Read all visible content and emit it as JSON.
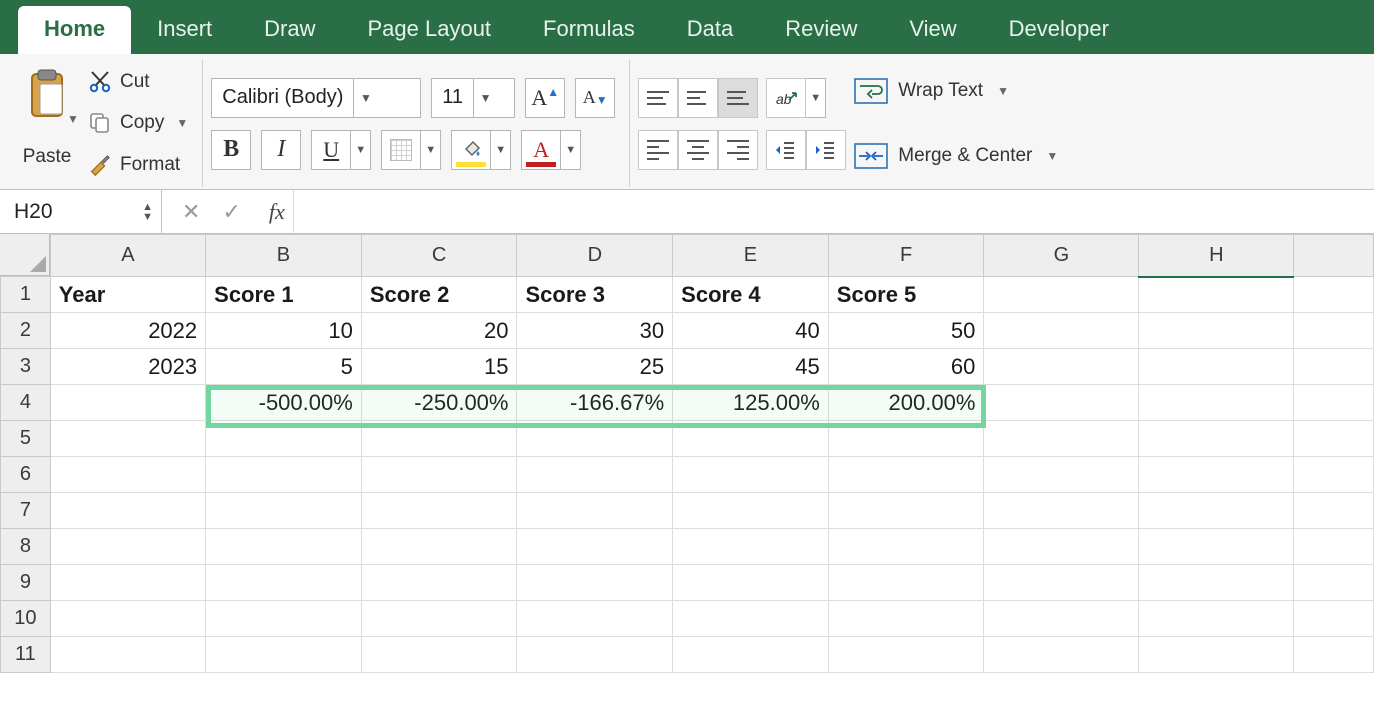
{
  "tabs": {
    "items": [
      "Home",
      "Insert",
      "Draw",
      "Page Layout",
      "Formulas",
      "Data",
      "Review",
      "View",
      "Developer"
    ],
    "active_index": 0
  },
  "ribbon": {
    "paste_label": "Paste",
    "cut_label": "Cut",
    "copy_label": "Copy",
    "format_label": "Format",
    "font_name": "Calibri (Body)",
    "font_size": "11",
    "wrap_label": "Wrap Text",
    "merge_label": "Merge & Center"
  },
  "namebox": {
    "value": "H20"
  },
  "formula_bar": {
    "value": ""
  },
  "columns": [
    "A",
    "B",
    "C",
    "D",
    "E",
    "F",
    "G",
    "H"
  ],
  "active_column": "H",
  "rows": [
    "1",
    "2",
    "3",
    "4",
    "5",
    "6",
    "7",
    "8",
    "9",
    "10",
    "11"
  ],
  "data": {
    "headers": [
      "Year",
      "Score 1",
      "Score 2",
      "Score 3",
      "Score 4",
      "Score 5"
    ],
    "r2": [
      "2022",
      "10",
      "20",
      "30",
      "40",
      "50"
    ],
    "r3": [
      "2023",
      "5",
      "15",
      "25",
      "45",
      "60"
    ],
    "r4": [
      "",
      "-500.00%",
      "-250.00%",
      "-166.67%",
      "125.00%",
      "200.00%"
    ]
  },
  "highlight": {
    "range": "B4:F4"
  },
  "active_cell": "H20",
  "chart_data": {
    "type": "table",
    "title": "",
    "columns": [
      "Year",
      "Score 1",
      "Score 2",
      "Score 3",
      "Score 4",
      "Score 5"
    ],
    "rows": [
      {
        "Year": 2022,
        "Score 1": 10,
        "Score 2": 20,
        "Score 3": 30,
        "Score 4": 40,
        "Score 5": 50
      },
      {
        "Year": 2023,
        "Score 1": 5,
        "Score 2": 15,
        "Score 3": 25,
        "Score 4": 45,
        "Score 5": 60
      },
      {
        "Year": null,
        "Score 1": "-500.00%",
        "Score 2": "-250.00%",
        "Score 3": "-166.67%",
        "Score 4": "125.00%",
        "Score 5": "200.00%"
      }
    ]
  }
}
